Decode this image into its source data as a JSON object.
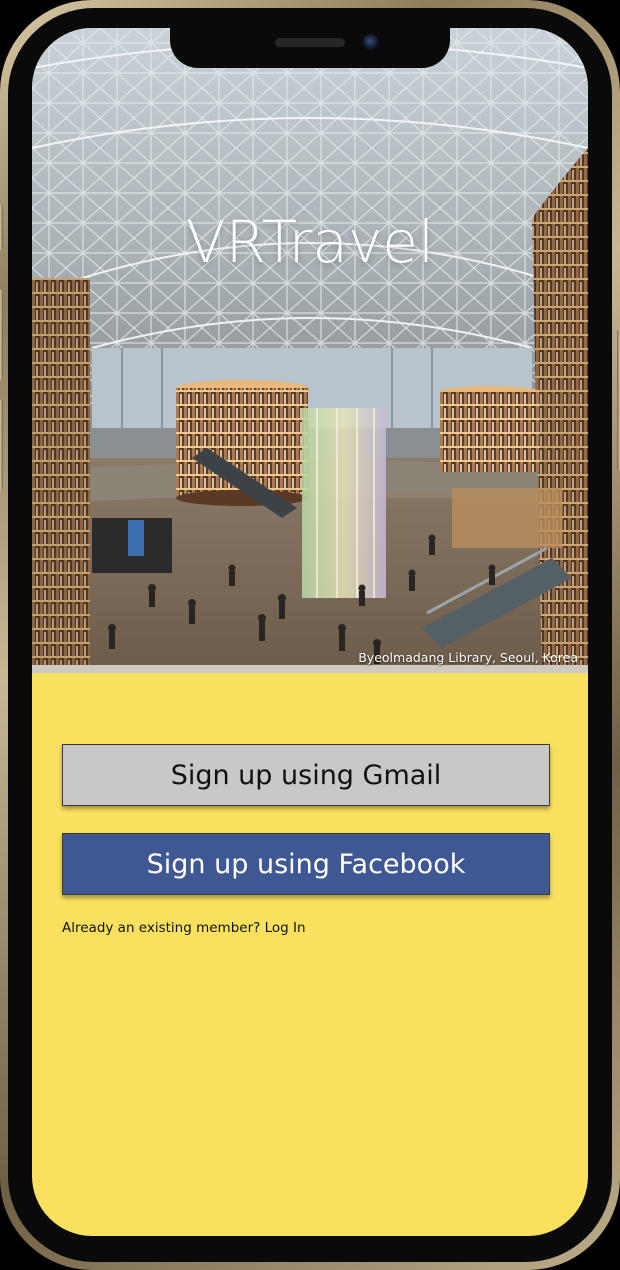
{
  "app": {
    "title": "VRTravel"
  },
  "hero": {
    "caption": "Byeolmadang Library, Seoul, Korea"
  },
  "auth": {
    "gmail_label": "Sign up using Gmail",
    "facebook_label": "Sign up using Facebook",
    "existing_member_text": "Already an existing member?",
    "login_label": "Log In"
  },
  "colors": {
    "background": "#f9e160",
    "gmail_button": "#c8c8c8",
    "facebook_button": "#3f5893",
    "phone_frame": "#c9b794"
  }
}
